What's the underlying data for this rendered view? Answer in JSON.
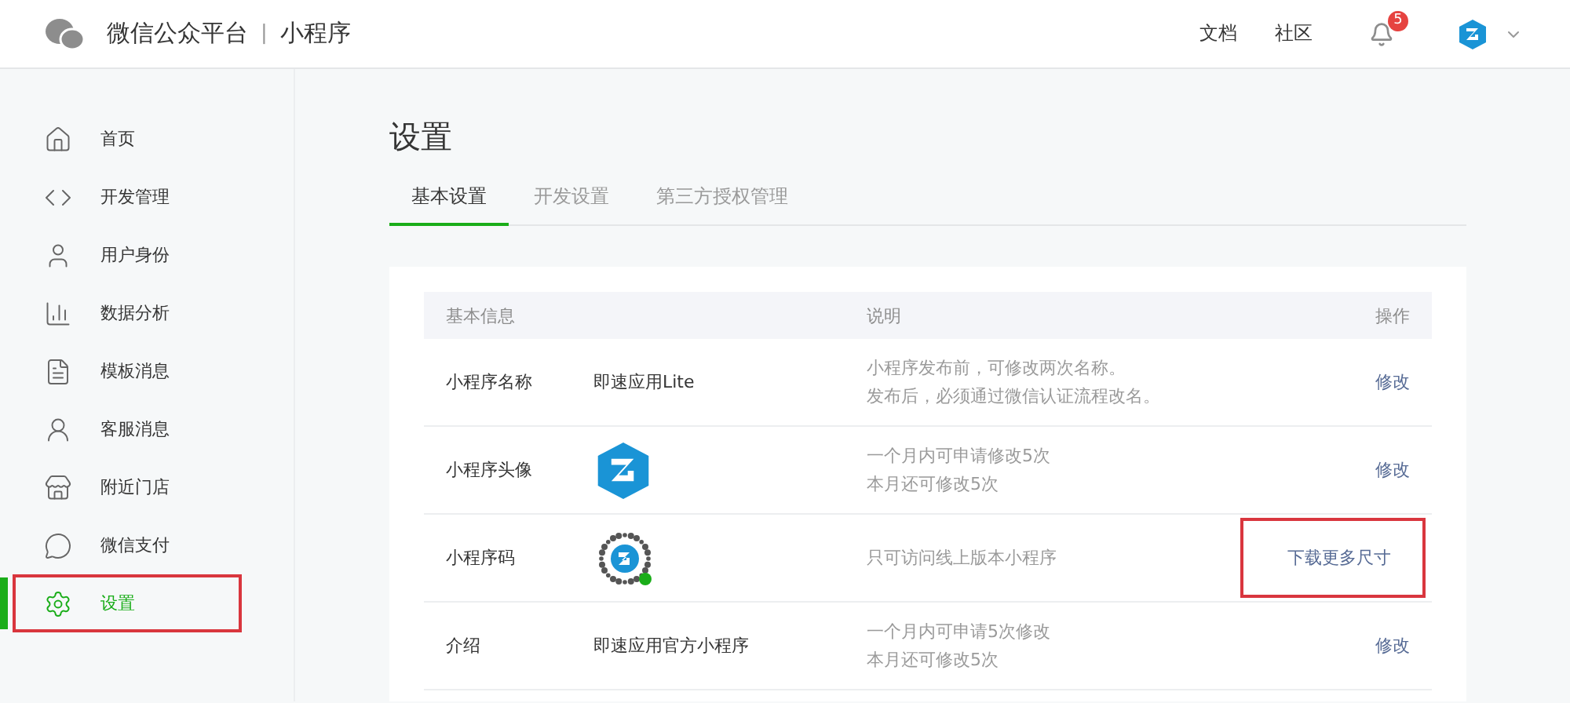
{
  "header": {
    "title": "微信公众平台",
    "separator": "|",
    "subtitle": "小程序",
    "links": [
      "文档",
      "社区"
    ],
    "notifications": "5"
  },
  "sidebar": {
    "items": [
      {
        "label": "首页",
        "selected": false,
        "annotated": false
      },
      {
        "label": "开发管理",
        "selected": false,
        "annotated": false
      },
      {
        "label": "用户身份",
        "selected": false,
        "annotated": false
      },
      {
        "label": "数据分析",
        "selected": false,
        "annotated": false
      },
      {
        "label": "模板消息",
        "selected": false,
        "annotated": false
      },
      {
        "label": "客服消息",
        "selected": false,
        "annotated": false
      },
      {
        "label": "附近门店",
        "selected": false,
        "annotated": false
      },
      {
        "label": "微信支付",
        "selected": false,
        "annotated": false
      },
      {
        "label": "设置",
        "selected": true,
        "annotated": true
      }
    ]
  },
  "page": {
    "title": "设置",
    "tabs": [
      {
        "label": "基本设置",
        "selected": true
      },
      {
        "label": "开发设置",
        "selected": false
      },
      {
        "label": "第三方授权管理",
        "selected": false
      }
    ]
  },
  "table": {
    "columns": [
      "基本信息",
      "说明",
      "操作"
    ],
    "rows": [
      {
        "kind": "text",
        "label": "小程序名称",
        "value": "即速应用Lite",
        "description": [
          "小程序发布前，可修改两次名称。",
          "发布后，必须通过微信认证流程改名。"
        ],
        "action": "修改",
        "annotated": false
      },
      {
        "kind": "avatar",
        "label": "小程序头像",
        "description": [
          "一个月内可申请修改5次",
          "本月还可修改5次"
        ],
        "action": "修改",
        "annotated": false
      },
      {
        "kind": "qrcode",
        "label": "小程序码",
        "description": [
          "只可访问线上版本小程序"
        ],
        "action": "下载更多尺寸",
        "annotated": true
      },
      {
        "kind": "text",
        "label": "介绍",
        "value": "即速应用官方小程序",
        "description": [
          "一个月内可申请5次修改",
          "本月还可修改5次"
        ],
        "action": "修改",
        "annotated": false
      }
    ]
  }
}
